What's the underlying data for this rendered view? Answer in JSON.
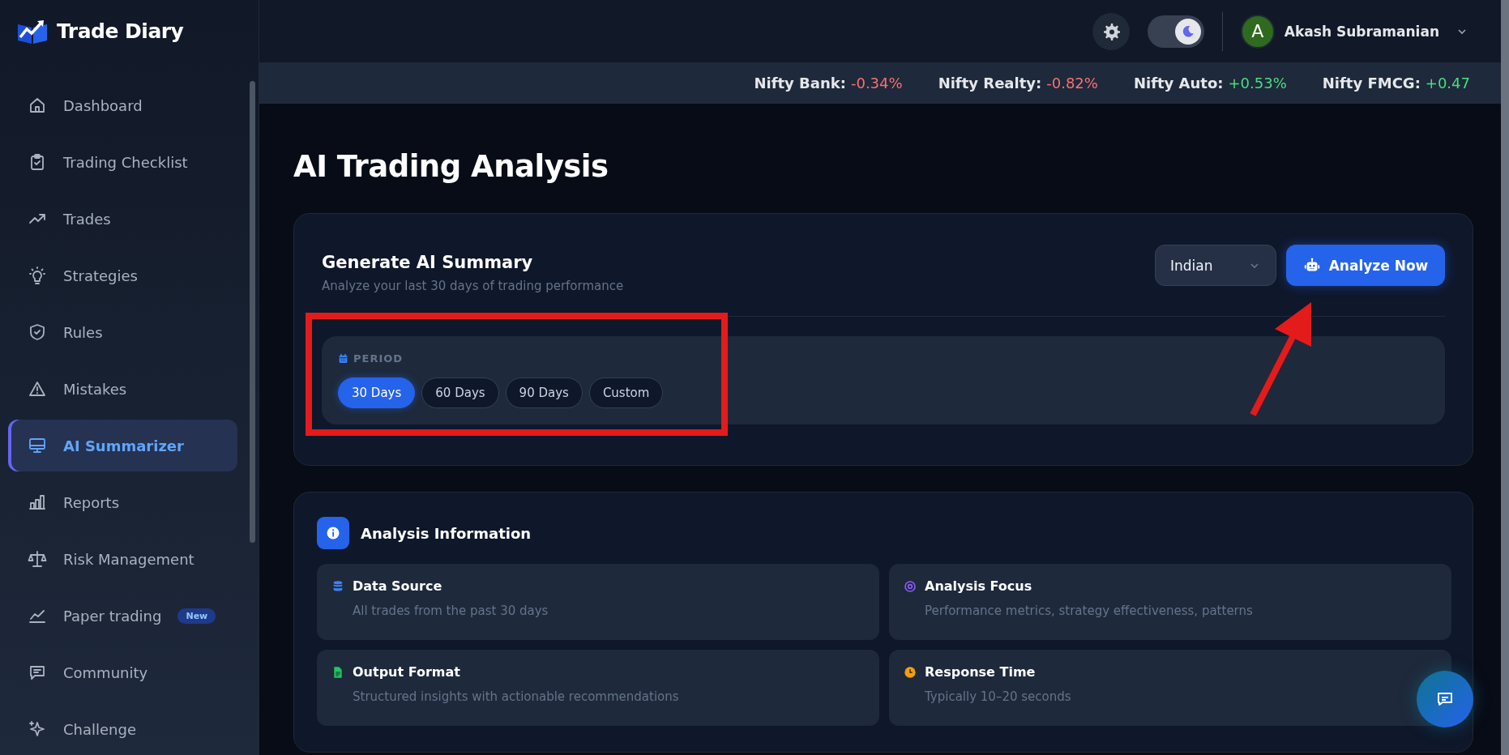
{
  "brand": {
    "name": "Trade Diary"
  },
  "sidebar": {
    "items": [
      {
        "label": "Dashboard",
        "selected": false
      },
      {
        "label": "Trading Checklist",
        "selected": false
      },
      {
        "label": "Trades",
        "selected": false
      },
      {
        "label": "Strategies",
        "selected": false
      },
      {
        "label": "Rules",
        "selected": false
      },
      {
        "label": "Mistakes",
        "selected": false
      },
      {
        "label": "AI Summarizer",
        "selected": true
      },
      {
        "label": "Reports",
        "selected": false
      },
      {
        "label": "Risk Management",
        "selected": false
      },
      {
        "label": "Paper trading",
        "selected": false,
        "badge": "New"
      },
      {
        "label": "Community",
        "selected": false
      },
      {
        "label": "Challenge",
        "selected": false
      }
    ]
  },
  "header": {
    "dark_mode": true,
    "user": {
      "initial": "A",
      "name": "Akash Subramanian"
    }
  },
  "ticker": [
    {
      "name": "Nifty Bank:",
      "change": "-0.34%",
      "color": "#f87171"
    },
    {
      "name": "Nifty Realty:",
      "change": "-0.82%",
      "color": "#f87171"
    },
    {
      "name": "Nifty Auto:",
      "change": "+0.53%",
      "color": "#4ade80"
    },
    {
      "name": "Nifty FMCG:",
      "change": "+0.47",
      "color": "#4ade80"
    }
  ],
  "page_title": "AI Trading Analysis",
  "summary_card": {
    "title": "Generate AI Summary",
    "subtitle": "Analyze your last 30 days of trading performance",
    "market": "Indian",
    "action": "Analyze Now",
    "period_label": "PERIOD",
    "periods": [
      {
        "label": "30 Days",
        "selected": true
      },
      {
        "label": "60 Days",
        "selected": false
      },
      {
        "label": "90 Days",
        "selected": false
      },
      {
        "label": "Custom",
        "selected": false
      }
    ]
  },
  "info_card": {
    "title": "Analysis Information",
    "items": [
      {
        "kind": "database",
        "title": "Data Source",
        "text": "All trades from the past 30 days",
        "color": "#3b82f6"
      },
      {
        "kind": "target",
        "title": "Analysis Focus",
        "text": "Performance metrics, strategy effectiveness, patterns",
        "color": "#8b5cf6"
      },
      {
        "kind": "document",
        "title": "Output Format",
        "text": "Structured insights with actionable recommendations",
        "color": "#22c55e"
      },
      {
        "kind": "clock",
        "title": "Response Time",
        "text": "Typically 10–20 seconds",
        "color": "#f59e0b"
      }
    ]
  },
  "annotations": {
    "highlight_box": true,
    "arrow": true
  }
}
